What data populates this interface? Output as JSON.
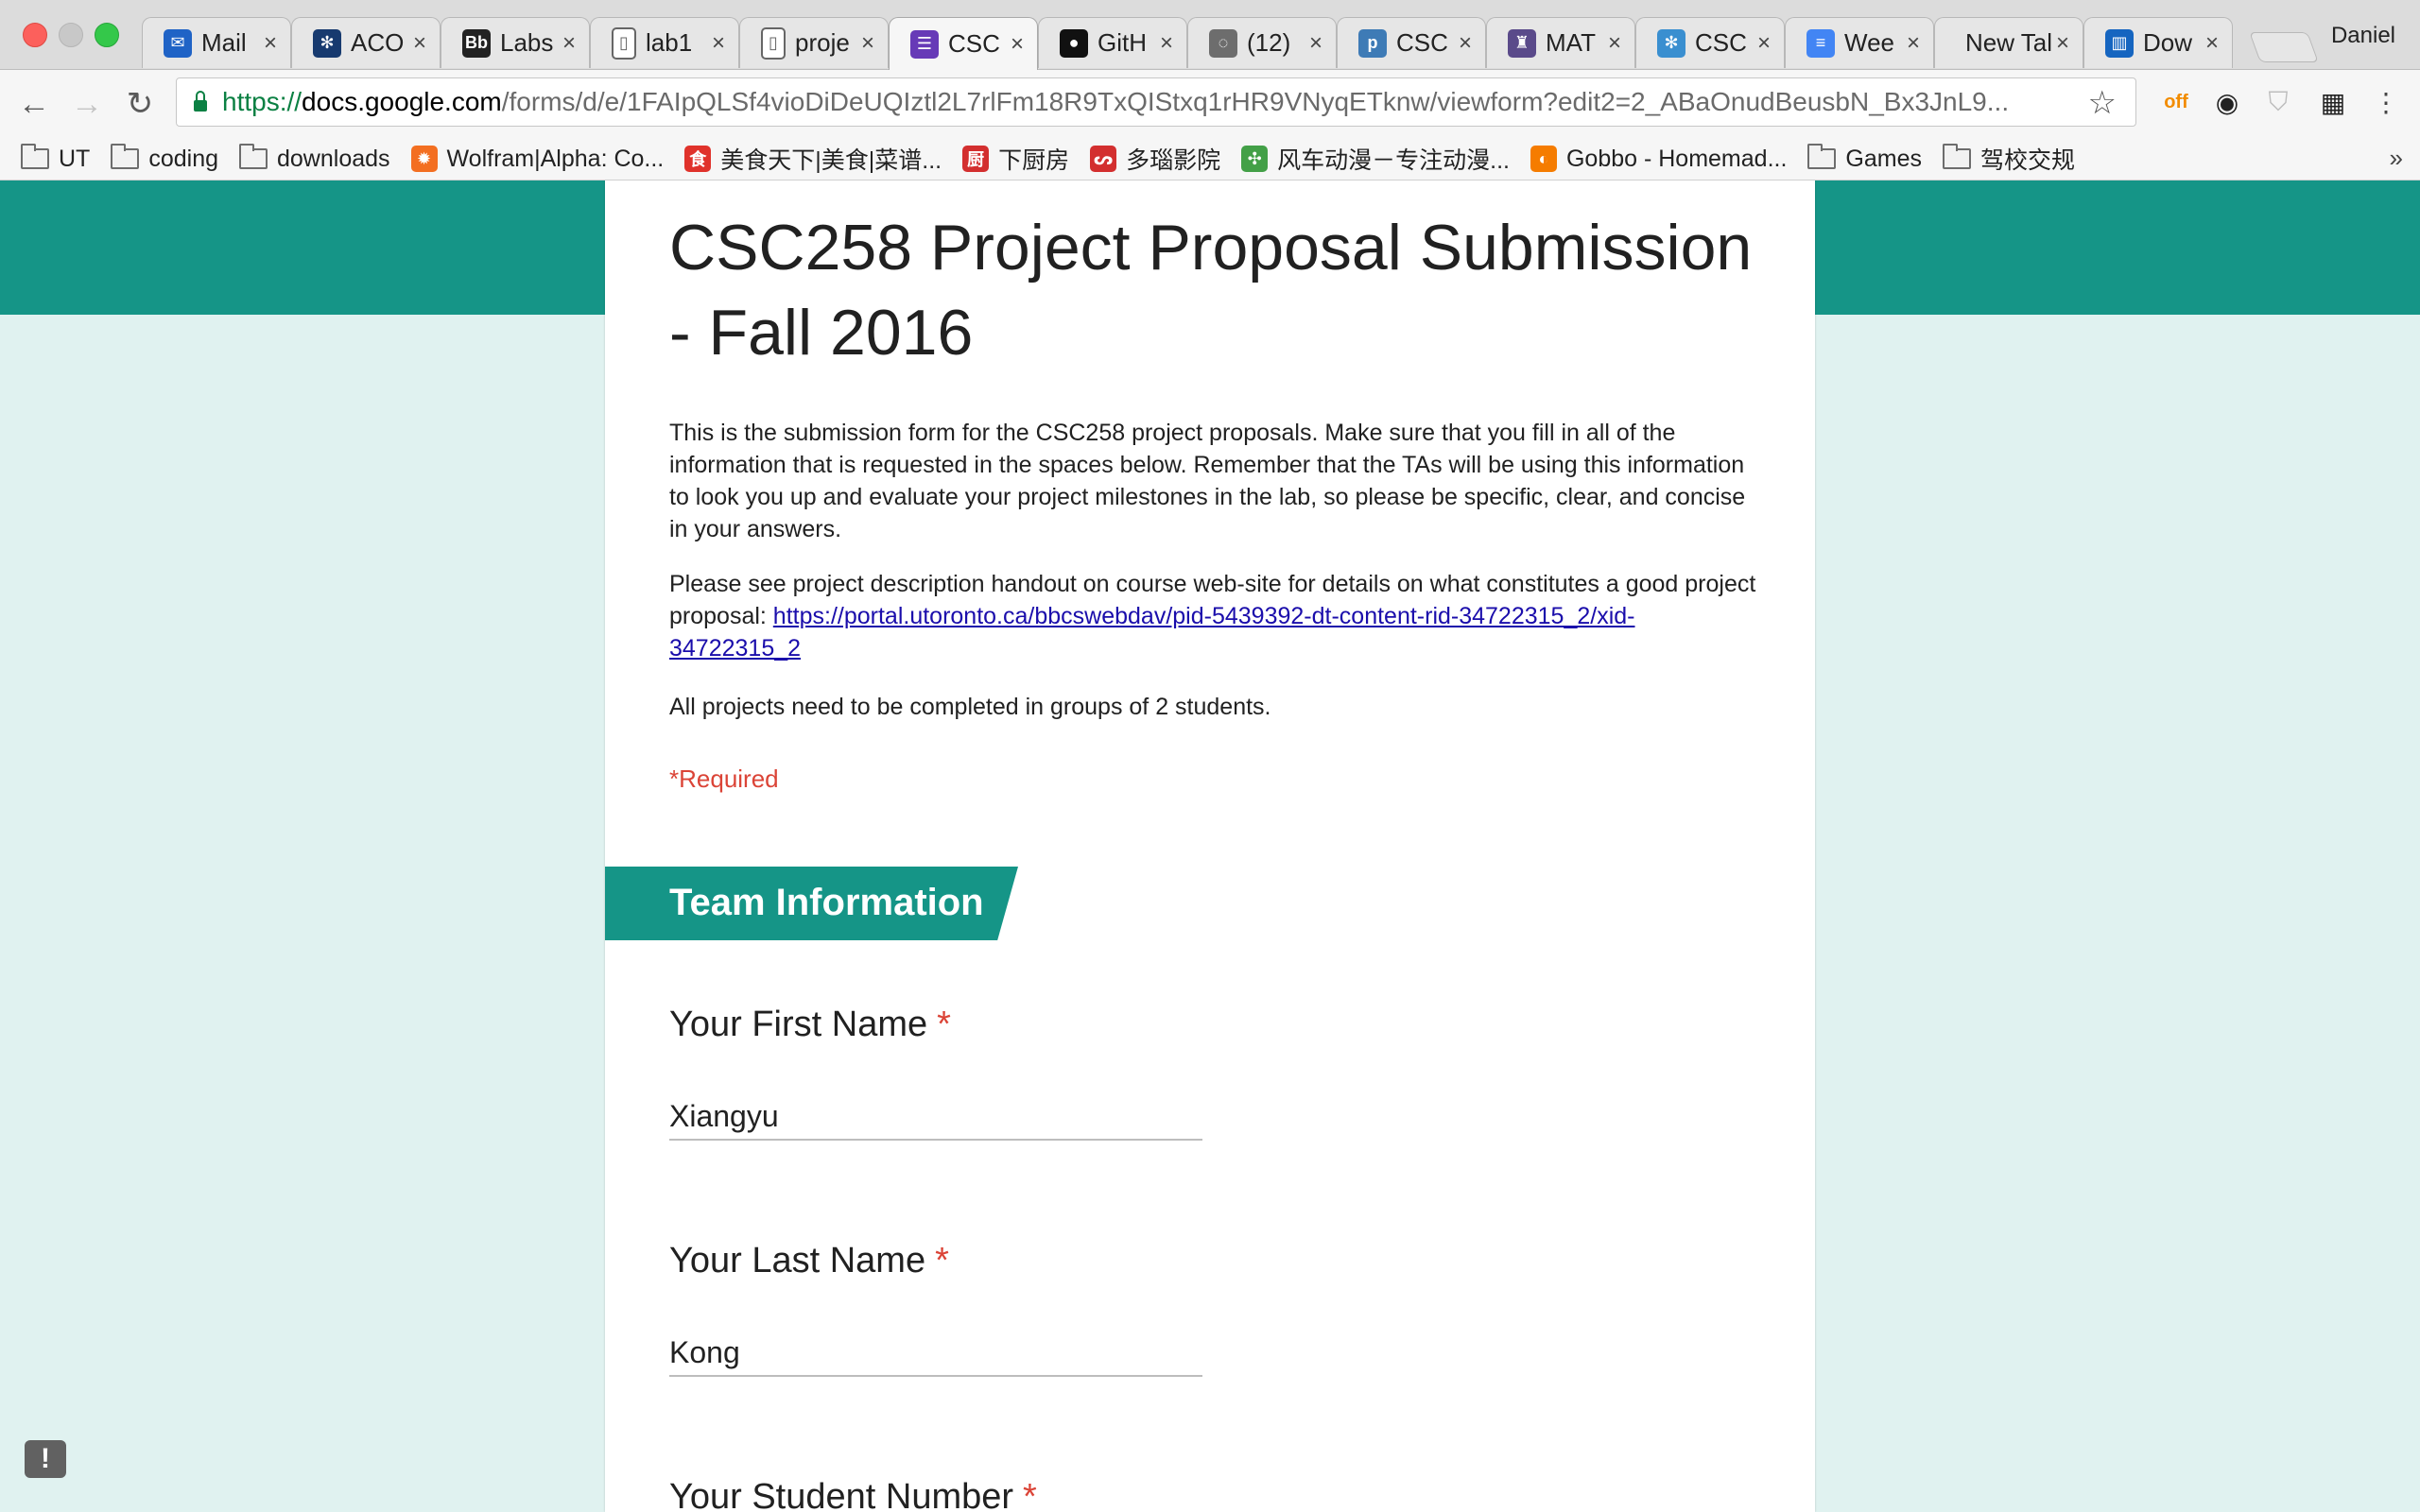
{
  "browser": {
    "profile_name": "Daniel",
    "tabs": [
      {
        "label": "Mail",
        "icon": "mail-icon",
        "icon_color": "#1f63c6",
        "glyph": "✉"
      },
      {
        "label": "ACO",
        "icon": "uoft-crest-icon",
        "icon_color": "#173a6f",
        "glyph": "✻"
      },
      {
        "label": "Labs",
        "icon": "blackboard-icon",
        "icon_color": "#222222",
        "glyph": "Bb"
      },
      {
        "label": "lab1",
        "icon": "document-icon",
        "icon_color": "#ffffff",
        "glyph": "▯"
      },
      {
        "label": "proje",
        "icon": "document-icon",
        "icon_color": "#ffffff",
        "glyph": "▯"
      },
      {
        "label": "CSC",
        "icon": "google-forms-icon",
        "icon_color": "#673ab7",
        "glyph": "☰",
        "active": true
      },
      {
        "label": "GitH",
        "icon": "github-icon",
        "icon_color": "#111111",
        "glyph": "●"
      },
      {
        "label": "(12)",
        "icon": "chat-bubble-icon",
        "icon_color": "#6d6d6d",
        "glyph": "◌"
      },
      {
        "label": "CSC",
        "icon": "piazza-icon",
        "icon_color": "#3e7bb6",
        "glyph": "p"
      },
      {
        "label": "MAT",
        "icon": "crest-icon",
        "icon_color": "#5a4a8a",
        "glyph": "♜"
      },
      {
        "label": "CSC",
        "icon": "uoft-crest-icon",
        "icon_color": "#3a8fd0",
        "glyph": "✻"
      },
      {
        "label": "Wee",
        "icon": "google-docs-icon",
        "icon_color": "#4285f4",
        "glyph": "≡"
      },
      {
        "label": "New Tal",
        "icon": "none",
        "icon_color": "#e6e6e6",
        "glyph": ""
      },
      {
        "label": "Dow",
        "icon": "download-chart-icon",
        "icon_color": "#1565c0",
        "glyph": "▥"
      }
    ],
    "url_scheme": "https://",
    "url_host": "docs.google.com",
    "url_path": "/forms/d/e/1FAIpQLSf4vioDiDeUQIztl2L7rlFm18R9TxQIStxq1rHR9VNyqETknw/viewform?edit2=2_ABaOnudBeusbN_Bx3JnL9...",
    "bookmarks": [
      {
        "label": "UT",
        "type": "folder"
      },
      {
        "label": "coding",
        "type": "folder"
      },
      {
        "label": "downloads",
        "type": "folder"
      },
      {
        "label": "Wolfram|Alpha: Co...",
        "type": "site",
        "icon_color": "#f36f21",
        "glyph": "✹"
      },
      {
        "label": "美食天下|美食|菜谱...",
        "type": "site",
        "icon_color": "#e0322b",
        "glyph": "食"
      },
      {
        "label": "下厨房",
        "type": "site",
        "icon_color": "#d32f2f",
        "glyph": "厨"
      },
      {
        "label": "多瑙影院",
        "type": "site",
        "icon_color": "#d32f2f",
        "glyph": "ᔕ"
      },
      {
        "label": "风车动漫－专注动漫...",
        "type": "site",
        "icon_color": "#43a047",
        "glyph": "✣"
      },
      {
        "label": "Gobbo - Homemad...",
        "type": "site",
        "icon_color": "#f57c00",
        "glyph": "◐"
      },
      {
        "label": "Games",
        "type": "folder"
      },
      {
        "label": "驾校交规",
        "type": "folder"
      }
    ],
    "bookmarks_overflow": "»"
  },
  "form": {
    "title": "CSC258 Project Proposal Submission - Fall 2016",
    "description_p1": "This is the submission form for the CSC258 project proposals. Make sure that you fill in all of the information that is requested in the spaces below. Remember that the TAs will be using this information to look you up and evaluate your project milestones in the lab, so please be specific, clear, and  concise in your answers.",
    "description_p2_prefix": "Please see project description handout on course web-site for details on what constitutes a good project proposal: ",
    "description_p2_link": "https://portal.utoronto.ca/bbcswebdav/pid-5439392-dt-content-rid-34722315_2/xid-34722315_2",
    "description_p3": "All projects need to be completed in groups of 2 students.",
    "required_note": "*Required",
    "section_title": "Team Information",
    "questions": [
      {
        "label": "Your First Name",
        "required_mark": "*",
        "value": "Xiangyu"
      },
      {
        "label": "Your Last Name",
        "required_mark": "*",
        "value": "Kong"
      },
      {
        "label": "Your Student Number",
        "required_mark": "*",
        "value": ""
      }
    ],
    "feedback_glyph": "!"
  },
  "colors": {
    "accent": "#159587",
    "page_background": "#e0f2f0",
    "required": "#db4437",
    "link": "#1a0dab"
  }
}
